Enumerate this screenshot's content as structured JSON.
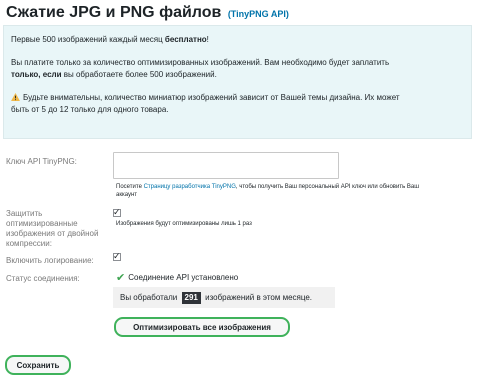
{
  "header": {
    "title": "Сжатие JPG и PNG файлов",
    "subtitle": "(TinyPNG API)"
  },
  "info": {
    "line1_prefix": "Первые 500 изображений каждый месяц ",
    "line1_bold": "бесплатно",
    "line1_suffix": "!",
    "line2": "Вы платите только за количество оптимизированных изображений. Вам необходимо будет заплатить",
    "line3_bold": "только, если",
    "line3_suffix": " вы обработаете более 500 изображений.",
    "line4": "Будьте внимательны, количество миниатюр изображений зависит от Вашей темы дизайна. Их может",
    "line5": "быть от 5 до 12 только для одного товара."
  },
  "form": {
    "api_key": {
      "label": "Ключ API TinyPNG:",
      "value": "",
      "desc_prefix": "Посетите ",
      "desc_link": "Страницу разработчика TinyPNG",
      "desc_suffix": ", чтобы получить Ваш персональный API ключ или обновить Ваш",
      "desc_line2": "аккаунт"
    },
    "protect": {
      "label_line1": "Защитить",
      "label_line2": "оптимизированные",
      "label_line3": "изображения от двойной",
      "label_line4": "компрессии:",
      "checked": true,
      "check_glyph": "✓",
      "desc": "Изображения будут оптимизированы лишь 1 раз"
    },
    "logging": {
      "label": "Включить логирование:",
      "checked": true,
      "check_glyph": "✓"
    },
    "status": {
      "label": "Статус соединения:",
      "icon_glyph": "✔",
      "text": "Соединение API установлено",
      "usage_prefix": "Вы обработали",
      "usage_count": "291",
      "usage_suffix": "изображений в этом месяце."
    },
    "optimize_button": "Оптимизировать все изображения",
    "save_button": "Сохранить"
  },
  "colors": {
    "accent": "#3fb25b",
    "link": "#0073aa",
    "info_bg": "#e9f6f8",
    "warning": "#f0b849"
  }
}
